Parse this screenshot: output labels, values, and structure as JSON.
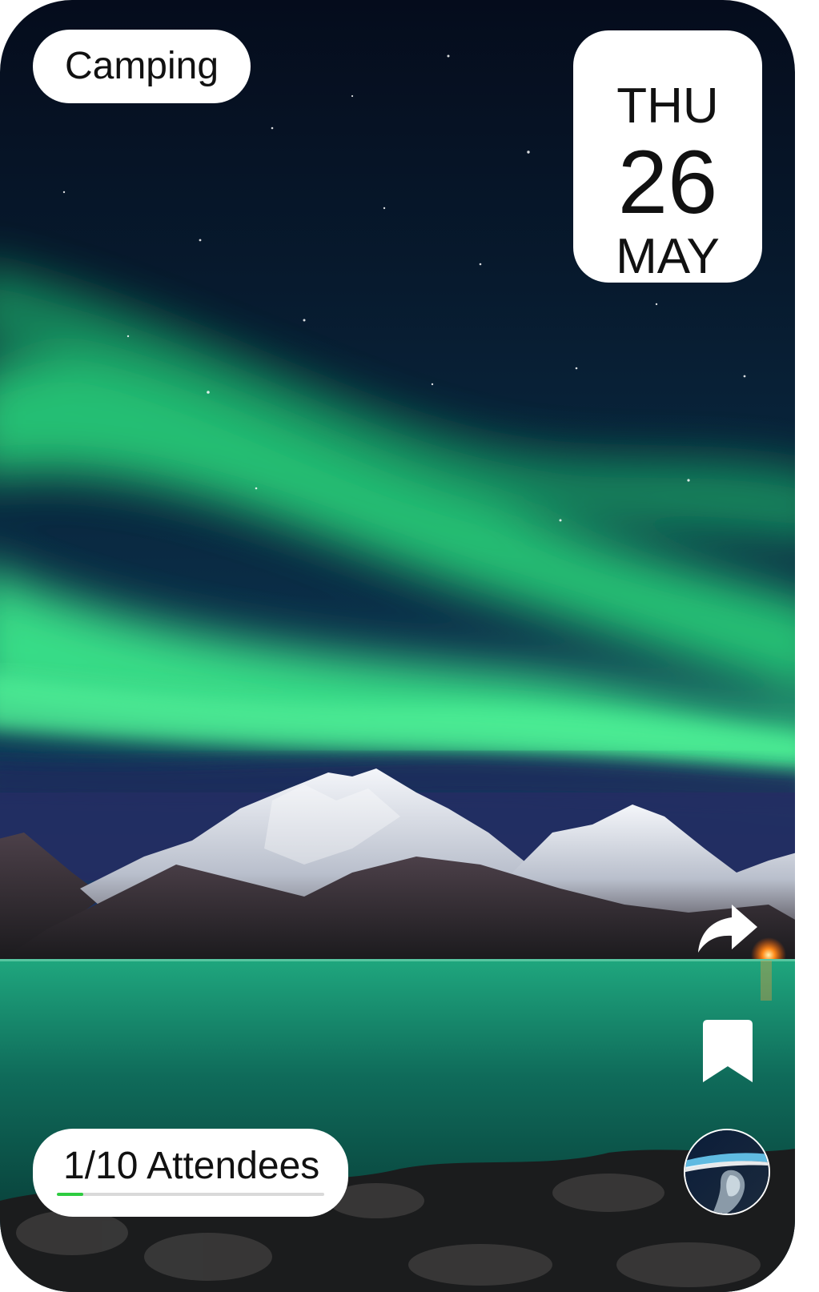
{
  "event": {
    "category": "Camping",
    "date": {
      "weekday": "THU",
      "day": "26",
      "month": "MAY"
    },
    "attendees": {
      "label": "1/10 Attendees",
      "current": 1,
      "capacity": 10
    }
  },
  "actions": {
    "share_icon": "share-arrow-icon",
    "bookmark_icon": "bookmark-icon"
  },
  "colors": {
    "progress": "#2ecc40",
    "aurora": "#2fd680",
    "sky": "#06122a"
  }
}
